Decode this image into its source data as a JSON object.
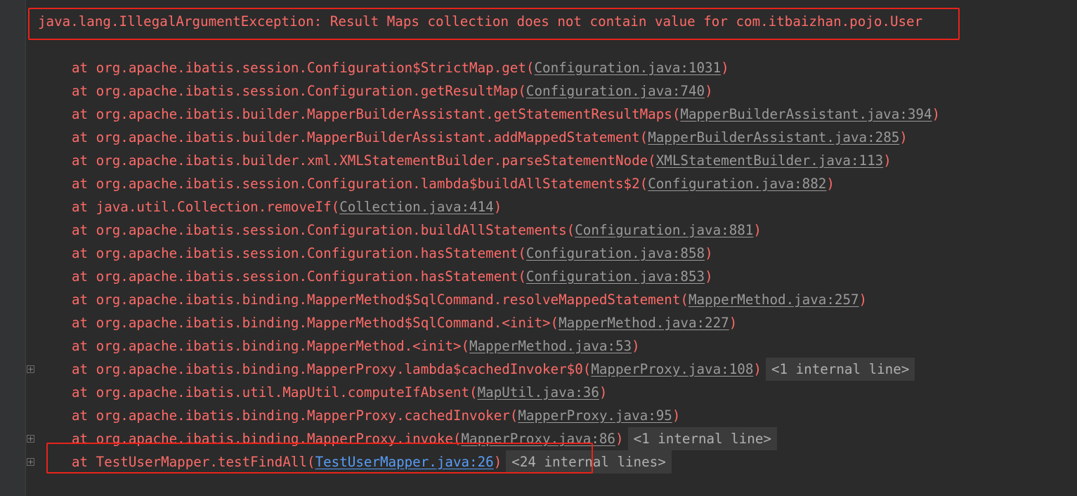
{
  "exception": {
    "message": "java.lang.IllegalArgumentException: Result Maps collection does not contain value for com.itbaizhan.pojo.User"
  },
  "highlight_color": "#e8231a",
  "frames": [
    {
      "prefix": "at org.apache.ibatis.session.Configuration$StrictMap.get(",
      "source": "Configuration.java:1031",
      "suffix": ")"
    },
    {
      "prefix": "at org.apache.ibatis.session.Configuration.getResultMap(",
      "source": "Configuration.java:740",
      "suffix": ")"
    },
    {
      "prefix": "at org.apache.ibatis.builder.MapperBuilderAssistant.getStatementResultMaps(",
      "source": "MapperBuilderAssistant.java:394",
      "suffix": ")"
    },
    {
      "prefix": "at org.apache.ibatis.builder.MapperBuilderAssistant.addMappedStatement(",
      "source": "MapperBuilderAssistant.java:285",
      "suffix": ")"
    },
    {
      "prefix": "at org.apache.ibatis.builder.xml.XMLStatementBuilder.parseStatementNode(",
      "source": "XMLStatementBuilder.java:113",
      "suffix": ")"
    },
    {
      "prefix": "at org.apache.ibatis.session.Configuration.lambda$buildAllStatements$2(",
      "source": "Configuration.java:882",
      "suffix": ")"
    },
    {
      "prefix": "at java.util.Collection.removeIf(",
      "source": "Collection.java:414",
      "suffix": ")"
    },
    {
      "prefix": "at org.apache.ibatis.session.Configuration.buildAllStatements(",
      "source": "Configuration.java:881",
      "suffix": ")"
    },
    {
      "prefix": "at org.apache.ibatis.session.Configuration.hasStatement(",
      "source": "Configuration.java:858",
      "suffix": ")"
    },
    {
      "prefix": "at org.apache.ibatis.session.Configuration.hasStatement(",
      "source": "Configuration.java:853",
      "suffix": ")"
    },
    {
      "prefix": "at org.apache.ibatis.binding.MapperMethod$SqlCommand.resolveMappedStatement(",
      "source": "MapperMethod.java:257",
      "suffix": ")"
    },
    {
      "prefix": "at org.apache.ibatis.binding.MapperMethod$SqlCommand.<init>(",
      "source": "MapperMethod.java:227",
      "suffix": ")"
    },
    {
      "prefix": "at org.apache.ibatis.binding.MapperMethod.<init>(",
      "source": "MapperMethod.java:53",
      "suffix": ")"
    },
    {
      "prefix": "at org.apache.ibatis.binding.MapperProxy.lambda$cachedInvoker$0(",
      "source": "MapperProxy.java:108",
      "suffix": ")",
      "internal": "<1 internal line>"
    },
    {
      "prefix": "at org.apache.ibatis.util.MapUtil.computeIfAbsent(",
      "source": "MapUtil.java:36",
      "suffix": ")"
    },
    {
      "prefix": "at org.apache.ibatis.binding.MapperProxy.cachedInvoker(",
      "source": "MapperProxy.java:95",
      "suffix": ")"
    },
    {
      "prefix": "at org.apache.ibatis.binding.MapperProxy.invoke(",
      "source": "MapperProxy.java:86",
      "suffix": ")",
      "internal": "<1 internal line>"
    },
    {
      "prefix": "at TestUserMapper.testFindAll(",
      "source": "TestUserMapper.java:26",
      "suffix": ")",
      "internal": "<24 internal lines>"
    }
  ]
}
